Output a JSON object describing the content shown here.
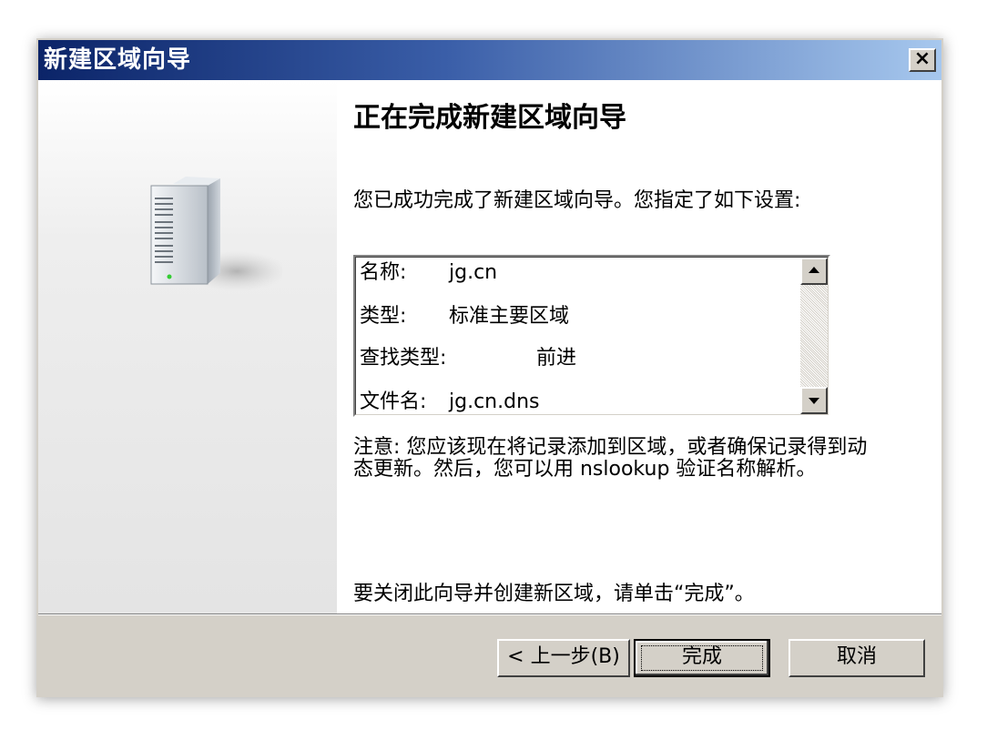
{
  "window": {
    "title": "新建区域向导",
    "close_label": "×"
  },
  "main": {
    "heading": "正在完成新建区域向导",
    "intro": "您已成功完成了新建区域向导。您指定了如下设置:",
    "settings": [
      {
        "label": "名称:",
        "value": "jg.cn"
      },
      {
        "label": "类型:",
        "value": "标准主要区域"
      },
      {
        "label": "查找类型:",
        "value": "前进"
      },
      {
        "label": "文件名:",
        "value": "jg.cn.dns"
      }
    ],
    "note": "注意: 您应该现在将记录添加到区域，或者确保记录得到动态更新。然后，您可以用 nslookup 验证名称解析。",
    "closing": "要关闭此向导并创建新区域，请单击“完成”。"
  },
  "buttons": {
    "back": "< 上一步(B)",
    "finish": "完成",
    "cancel": "取消"
  },
  "colors": {
    "titlebar_start": "#0b2468",
    "titlebar_end": "#a7c8ee",
    "dialog_face": "#d4d0c8"
  },
  "icons": {
    "wizard_graphic": "server-icon"
  }
}
